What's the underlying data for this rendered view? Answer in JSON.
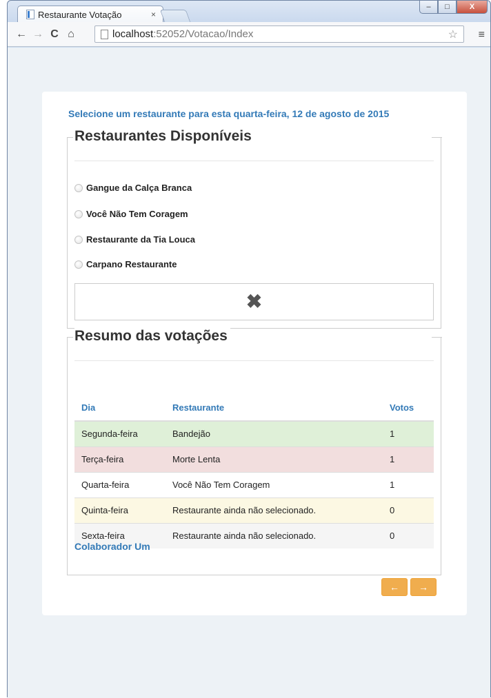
{
  "browser": {
    "tab_title": "Restaurante Votação",
    "tab_close": "×",
    "url_host": "localhost",
    "url_path": ":52052/Votacao/Index",
    "window_buttons": {
      "minimize": "–",
      "maximize": "□",
      "close": "X"
    },
    "nav": {
      "back": "←",
      "forward": "→",
      "reload": "C",
      "home": "⌂",
      "star": "☆",
      "menu": "≡"
    }
  },
  "page": {
    "headline": "Selecione um restaurante para esta quarta-feira, 12 de agosto de 2015",
    "available": {
      "legend": "Restaurantes Disponíveis",
      "options": [
        "Gangue da Calça Branca",
        "Você Não Tem Coragem",
        "Restaurante da Tia Louca",
        "Carpano Restaurante"
      ],
      "clear_icon": "✖"
    },
    "summary": {
      "legend": "Resumo das votações",
      "headers": [
        "Dia",
        "Restaurante",
        "Votos"
      ],
      "rows": [
        {
          "day": "Segunda-feira",
          "restaurant": "Bandejão",
          "votes": "1",
          "style": "success"
        },
        {
          "day": "Terça-feira",
          "restaurant": "Morte Lenta",
          "votes": "1",
          "style": "danger"
        },
        {
          "day": "Quarta-feira",
          "restaurant": "Você Não Tem Coragem",
          "votes": "1",
          "style": "none"
        },
        {
          "day": "Quinta-feira",
          "restaurant": "Restaurante ainda não selecionado.",
          "votes": "0",
          "style": "warning"
        },
        {
          "day": "Sexta-feira",
          "restaurant": "Restaurante ainda não selecionado.",
          "votes": "0",
          "style": "active"
        }
      ],
      "user": "Colaborador Um"
    },
    "pager": {
      "prev": "←",
      "next": "→"
    }
  },
  "colors": {
    "primary": "#337ab7",
    "warning_button": "#f0ad4e",
    "row_success": "#dff0d8",
    "row_danger": "#f2dede",
    "row_warning": "#fcf8e3",
    "row_active": "#f5f5f5"
  }
}
